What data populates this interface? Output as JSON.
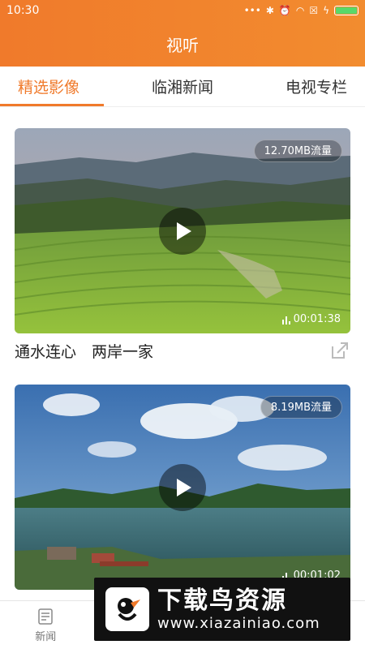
{
  "status_bar": {
    "time": "10:30"
  },
  "header": {
    "title": "视听"
  },
  "tabs": [
    {
      "label": "精选影像",
      "active": true
    },
    {
      "label": "临湘新闻",
      "active": false
    },
    {
      "label": "电视专栏",
      "active": false
    }
  ],
  "videos": [
    {
      "title": "通水连心　两岸一家",
      "size": "12.70MB流量",
      "duration": "00:01:38"
    },
    {
      "title": "",
      "size": "8.19MB流量",
      "duration": "00:01:02"
    }
  ],
  "bottom_nav": [
    {
      "label": "新闻",
      "active": false
    }
  ],
  "watermark": {
    "title": "下载鸟资源",
    "url": "www.xiazainiao.com"
  },
  "colors": {
    "accent": "#f07a2b"
  }
}
